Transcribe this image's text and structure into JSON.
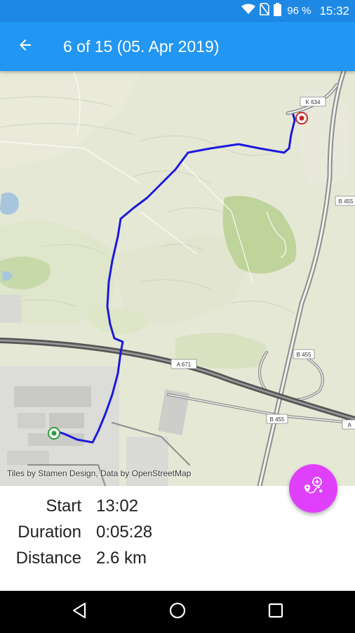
{
  "status_bar": {
    "battery_text": "96 %",
    "time": "15:32",
    "icons": [
      "wifi-icon",
      "no-sim-icon",
      "battery-icon"
    ]
  },
  "app_bar": {
    "title": "6 of 15 (05. Apr 2019)",
    "back_icon": "arrow-back-icon",
    "color": "#2196f3"
  },
  "map": {
    "attribution": "Tiles by Stamen Design, Data by OpenStreetMap",
    "road_labels": [
      "K 634",
      "B 455",
      "A 671",
      "B 455",
      "B 455",
      "A"
    ],
    "track_color": "#1a1adb",
    "start_marker_color": "#2e9e3c",
    "end_marker_color": "#c62828"
  },
  "fab": {
    "icon": "route-add-icon",
    "color": "#e040fb"
  },
  "info": {
    "start_label": "Start",
    "start_value": "13:02",
    "duration_label": "Duration",
    "duration_value": "0:05:28",
    "distance_label": "Distance",
    "distance_value": "2.6 km"
  },
  "nav_bar": {
    "icons": [
      "back-triangle-icon",
      "home-circle-icon",
      "recents-square-icon"
    ]
  }
}
